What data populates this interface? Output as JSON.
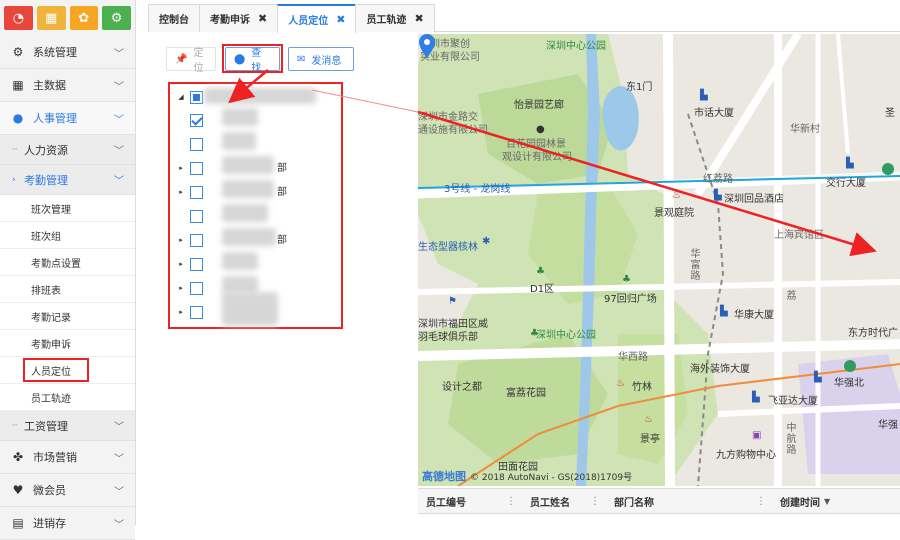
{
  "quick_bar": {
    "buttons": [
      {
        "icon": "dashboard-icon",
        "glyph": "◔",
        "color": "#e8463c"
      },
      {
        "icon": "calendar-icon",
        "glyph": "▦",
        "color": "#f0b43c"
      },
      {
        "icon": "group-icon",
        "glyph": "✿",
        "color": "#f6a623"
      },
      {
        "icon": "share-icon",
        "glyph": "⚙",
        "color": "#4caf50"
      }
    ]
  },
  "sidebar": {
    "system": "系统管理",
    "master_data": "主数据",
    "hr": "人事管理",
    "hr_resources": "人力资源",
    "attendance": "考勤管理",
    "attendance_items": [
      "班次管理",
      "班次组",
      "考勤点设置",
      "排班表",
      "考勤记录",
      "考勤申诉",
      "人员定位",
      "员工轨迹"
    ],
    "payroll": "工资管理",
    "marketing": "市场营销",
    "members": "微会员",
    "inventory": "进销存"
  },
  "tabs": [
    {
      "label": "控制台",
      "closable": false
    },
    {
      "label": "考勤申诉",
      "closable": true
    },
    {
      "label": "人员定位",
      "closable": true,
      "active": true
    },
    {
      "label": "员工轨迹",
      "closable": true
    }
  ],
  "tab_close_glyph": "✖",
  "toolbar": {
    "locate": "定位",
    "find": "查找",
    "send_message": "发消息"
  },
  "tree": {
    "suffixes": [
      "部",
      "部",
      "部"
    ]
  },
  "map": {
    "labels": {
      "l1": "深圳市聚创",
      "l2": "实业有限公司",
      "l3": "深圳中心公园",
      "l4": "怡景园艺廊",
      "l5": "东1门",
      "l6": "市话大厦",
      "l7": "深圳市金路交",
      "l8": "通设施有限公司",
      "l9": "百花园园林景",
      "l10": "观设计有限公司",
      "l11": "华侨城",
      "l12": "红荔路",
      "l13": "交行大厦",
      "l14": "深圳回品酒店",
      "l15": "3号线 - 龙岗线",
      "l16": "景观庭院",
      "l17": "生态型器核林",
      "l18": "华富路",
      "l19": "D1区",
      "l20": "97回归广场",
      "l21": "华康大厦",
      "l22": "东方时代广",
      "l23": "深圳市福田区威",
      "l24": "羽毛球俱乐部",
      "l25": "深圳中心公园",
      "l26": "华西路",
      "l27": "设计之都",
      "l28": "富荔花园",
      "l29": "竹林",
      "l30": "海外装饰大厦",
      "l31": "华强北",
      "l32": "飞亚达大厦",
      "l33": "景亭",
      "l34": "九方购物中心",
      "l35": "田面花园",
      "l36": "华强",
      "l37": "中航路",
      "l38": "圣",
      "l39": "华新村",
      "l40": "上海宾馆区",
      "l41": "荔"
    },
    "attribution": "© 2018 AutoNavi - GS(2018)1709号",
    "logo": "高德地图"
  },
  "grid": {
    "columns": [
      {
        "label": "员工编号"
      },
      {
        "label": "员工姓名"
      },
      {
        "label": "部门名称"
      },
      {
        "label": "创建时间",
        "sort": "▼"
      }
    ]
  },
  "accent_color": "#2a7ae2",
  "highlight_color": "#e22222"
}
